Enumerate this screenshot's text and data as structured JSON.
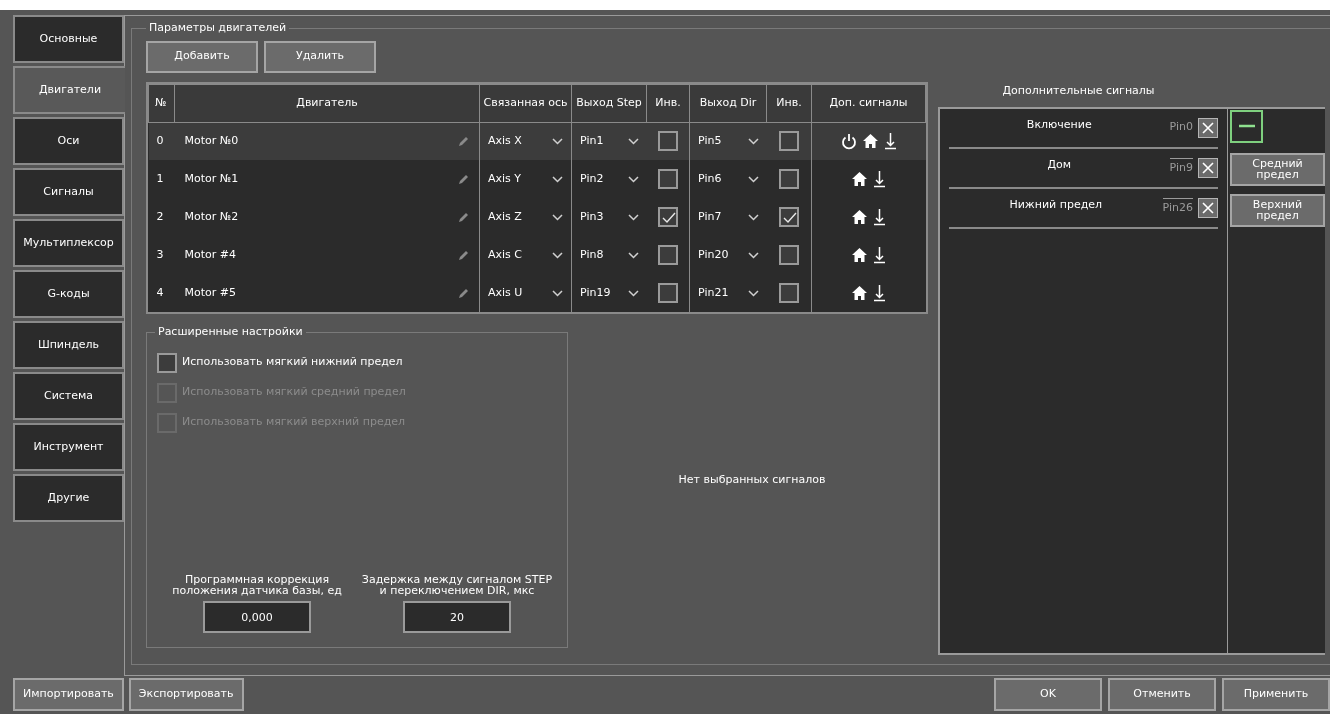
{
  "sidebar": {
    "items": [
      {
        "label": "Основные",
        "selected": false
      },
      {
        "label": "Двигатели",
        "selected": true
      },
      {
        "label": "Оси",
        "selected": false
      },
      {
        "label": "Сигналы",
        "selected": false
      },
      {
        "label": "Мультиплексор",
        "selected": false
      },
      {
        "label": "G-коды",
        "selected": false
      },
      {
        "label": "Шпиндель",
        "selected": false
      },
      {
        "label": "Система",
        "selected": false
      },
      {
        "label": "Инструмент",
        "selected": false
      },
      {
        "label": "Другие",
        "selected": false
      }
    ]
  },
  "motors_group": {
    "title": "Параметры двигателей",
    "buttons": [
      "Добавить",
      "Удалить"
    ]
  },
  "table": {
    "columns": [
      "№",
      "Двигатель",
      "Связанная ось",
      "Выход Step",
      "Инв.",
      "Выход Dir",
      "Инв.",
      "Доп. сигналы"
    ],
    "rows": [
      {
        "num": "0",
        "name": "Motor №0",
        "axis": "Axis X",
        "step": "Pin1",
        "step_inverted": false,
        "dir": "Pin5",
        "dir_inverted": false,
        "signals": [
          {
            "kind": "power"
          },
          {
            "kind": "home"
          },
          {
            "kind": "lower_limit"
          }
        ],
        "selected": true
      },
      {
        "num": "1",
        "name": "Motor №1",
        "axis": "Axis Y",
        "step": "Pin2",
        "step_inverted": false,
        "dir": "Pin6",
        "dir_inverted": false,
        "signals": [
          {
            "kind": "home"
          },
          {
            "kind": "lower_limit"
          }
        ],
        "selected": false
      },
      {
        "num": "2",
        "name": "Motor №2",
        "axis": "Axis Z",
        "step": "Pin3",
        "step_inverted": true,
        "dir": "Pin7",
        "dir_inverted": true,
        "signals": [
          {
            "kind": "home"
          },
          {
            "kind": "lower_limit"
          }
        ],
        "selected": false
      },
      {
        "num": "3",
        "name": "Motor #4",
        "axis": "Axis C",
        "step": "Pin8",
        "step_inverted": false,
        "dir": "Pin20",
        "dir_inverted": false,
        "signals": [
          {
            "kind": "home"
          },
          {
            "kind": "lower_limit"
          }
        ],
        "selected": false
      },
      {
        "num": "4",
        "name": "Motor #5",
        "axis": "Axis U",
        "step": "Pin19",
        "step_inverted": false,
        "dir": "Pin21",
        "dir_inverted": false,
        "signals": [
          {
            "kind": "home"
          },
          {
            "kind": "lower_limit"
          }
        ],
        "selected": false
      }
    ]
  },
  "advanced": {
    "title": "Расширенные настройки",
    "options": [
      {
        "label": "Использовать мягкий нижний предел",
        "checked": false,
        "disabled": false
      },
      {
        "label": "Использовать мягкий средний предел",
        "checked": false,
        "disabled": true
      },
      {
        "label": "Использовать мягкий верхний предел",
        "checked": false,
        "disabled": true
      }
    ],
    "fields": [
      {
        "label": "Программная коррекция положения датчика базы, ед",
        "value": "0,000"
      },
      {
        "label": "Задержка между сигналом STEP и переключением DIR, мкс",
        "value": "20"
      }
    ]
  },
  "no_signals_text": "Нет выбранных сигналов",
  "extra_signals": {
    "title": "Дополнительные сигналы",
    "items": [
      {
        "label": "Включение",
        "pin": "Pin0",
        "inverted": false
      },
      {
        "label": "Дом",
        "pin": "Pin9",
        "inverted": true
      },
      {
        "label": "Нижний предел",
        "pin": "Pin26",
        "inverted": true
      }
    ],
    "buttons": [
      {
        "kind": "remove"
      },
      {
        "kind": "text",
        "label": "Средний предел"
      },
      {
        "kind": "text",
        "label": "Верхний предел"
      }
    ]
  },
  "footer": {
    "left_buttons": [
      "Импортировать",
      "Экспортировать"
    ],
    "right_buttons": [
      "OK",
      "Отменить",
      "Применить"
    ]
  }
}
